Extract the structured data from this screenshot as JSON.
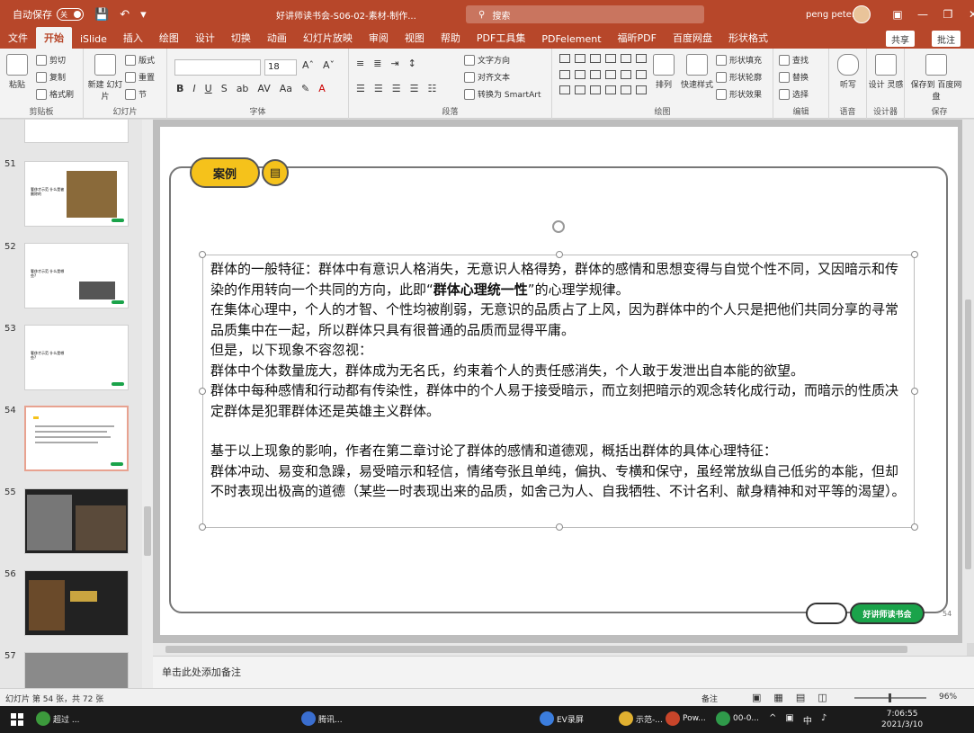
{
  "titlebar": {
    "autosave_label": "自动保存",
    "autosave_state": "关",
    "document_title": "好讲师读书会-S06-02-素材-制作...",
    "search_placeholder": "搜索",
    "user_name": "peng peter"
  },
  "tabs": [
    "文件",
    "开始",
    "iSlide",
    "插入",
    "绘图",
    "设计",
    "切换",
    "动画",
    "幻灯片放映",
    "审阅",
    "视图",
    "帮助",
    "PDF工具集",
    "PDFelement",
    "福昕PDF",
    "百度网盘",
    "形状格式"
  ],
  "active_tab": "开始",
  "share_label": "共享",
  "comment_label": "批注",
  "ribbon": {
    "clipboard": {
      "label": "剪贴板",
      "paste": "粘贴",
      "cut": "剪切",
      "copy": "复制",
      "format_painter": "格式刷"
    },
    "slides": {
      "label": "幻灯片",
      "new_slide": "新建\n幻灯片",
      "layout": "版式",
      "reset": "重置",
      "section": "节"
    },
    "font": {
      "label": "字体",
      "size": "18"
    },
    "paragraph": {
      "label": "段落",
      "text_direction": "文字方向",
      "align_text": "对齐文本",
      "smartart": "转换为 SmartArt"
    },
    "drawing": {
      "label": "绘图",
      "arrange": "排列",
      "quick_styles": "快速样式",
      "shape_fill": "形状填充",
      "shape_outline": "形状轮廓",
      "shape_effects": "形状效果"
    },
    "editing": {
      "label": "编辑",
      "find": "查找",
      "replace": "替换",
      "select": "选择"
    },
    "voice": {
      "label": "语音",
      "dictate": "听写"
    },
    "designer": {
      "label": "设计器",
      "design_ideas": "设计\n灵感"
    },
    "save": {
      "label": "保存",
      "save_baidu": "保存到\n百度网盘"
    }
  },
  "thumbnails": [
    {
      "num": "51",
      "text": "奢侈才示范\n什么是被删除的"
    },
    {
      "num": "52",
      "text": "奢侈才示范\n什么是哪些?"
    },
    {
      "num": "53",
      "text": "奢侈才示范\n什么是哪些?"
    },
    {
      "num": "54",
      "text": ""
    },
    {
      "num": "55",
      "text": ""
    },
    {
      "num": "56",
      "text": ""
    },
    {
      "num": "57",
      "text": ""
    }
  ],
  "slide": {
    "tag": "案例",
    "paragraphs": [
      {
        "pre": "群体的一般特征：群体中有意识人格消失，无意识人格得势，群体的感情和思想变得与自觉个性不同，又因暗示和传染的作用转向一个共同的方向，此即“",
        "bold": "群体心理统一性",
        "post": "”的心理学规律。"
      },
      {
        "pre": "在集体心理中，个人的才智、个性均被削弱，无意识的品质占了上风，因为群体中的个人只是把他们共同分享的寻常品质集中在一起，所以群体只具有很普通的品质而显得平庸。",
        "bold": "",
        "post": ""
      },
      {
        "pre": "但是，以下现象不容忽视：",
        "bold": "",
        "post": ""
      },
      {
        "pre": "群体中个体数量庞大，群体成为无名氏，约束着个人的责任感消失，个人敢于发泄出自本能的欲望。",
        "bold": "",
        "post": ""
      },
      {
        "pre": "群体中每种感情和行动都有传染性，群体中的个人易于接受暗示，而立刻把暗示的观念转化成行动，而暗示的性质决定群体是犯罪群体还是英雄主义群体。",
        "bold": "",
        "post": ""
      },
      {
        "pre": "",
        "bold": "",
        "post": ""
      },
      {
        "pre": "基于以上现象的影响，作者在第二章讨论了群体的感情和道德观，概括出群体的具体心理特征：",
        "bold": "",
        "post": ""
      },
      {
        "pre": "群体冲动、易变和急躁，易受暗示和轻信，情绪夸张且单纯，偏执、专横和保守，虽经常放纵自己低劣的本能，但却不时表现出极高的道德（某些一时表现出来的品质，如舍己为人、自我牺牲、不计名利、献身精神和对平等的渴望）。",
        "bold": "",
        "post": ""
      }
    ],
    "footer_brand": "好讲师读书会",
    "page_number": "54"
  },
  "notes_placeholder": "单击此处添加备注",
  "status": {
    "slide_count": "幻灯片 第 54 张，共 72 张",
    "notes_btn": "备注",
    "zoom": "96%"
  },
  "taskbar": {
    "items": [
      "超过 ...",
      "腾讯...",
      "EV录屏",
      "示范-...",
      "Pow...",
      "00-0..."
    ],
    "tray_lang": "中",
    "time": "7:06:55",
    "date": "2021/3/10"
  },
  "colors": {
    "accent": "#b7472a",
    "tag_yellow": "#f5c21b",
    "brand_green": "#1aa34a"
  }
}
